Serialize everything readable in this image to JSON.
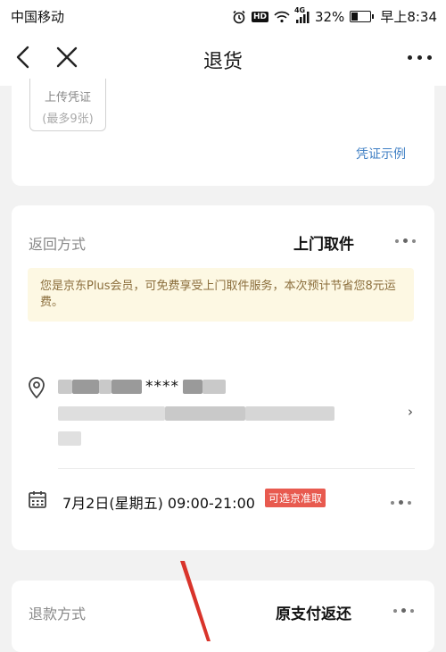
{
  "status_bar": {
    "carrier": "中国移动",
    "battery": "32%",
    "battery_level": 0.32,
    "time": "早上8:34",
    "network": "4G",
    "icons": [
      "alarm-icon",
      "hd-icon",
      "wifi-icon",
      "signal-icon",
      "battery-icon"
    ]
  },
  "nav": {
    "title": "退货",
    "back_icon": "back-chevron-icon",
    "close_icon": "close-icon",
    "more_icon": "more-icon"
  },
  "upload": {
    "label": "上传凭证",
    "hint": "(最多9张)",
    "example_link": "凭证示例"
  },
  "return_method": {
    "label": "返回方式",
    "value": "上门取件",
    "notice": "您是京东Plus会员，可免费享受上门取件服务，本次预计节省您8元运费。",
    "address_masked": "****",
    "pickup_time": "7月2日(星期五) 09:00-21:00",
    "pickup_tag": "可选京准取"
  },
  "refund_method": {
    "label": "退款方式",
    "value": "原支付返还"
  },
  "colors": {
    "accent_red": "#e85a4f",
    "link_blue": "#3f7fc4",
    "notice_bg": "#fdf8e3",
    "notice_text": "#8a6d3b",
    "annotation_arrow": "#d9342b"
  }
}
